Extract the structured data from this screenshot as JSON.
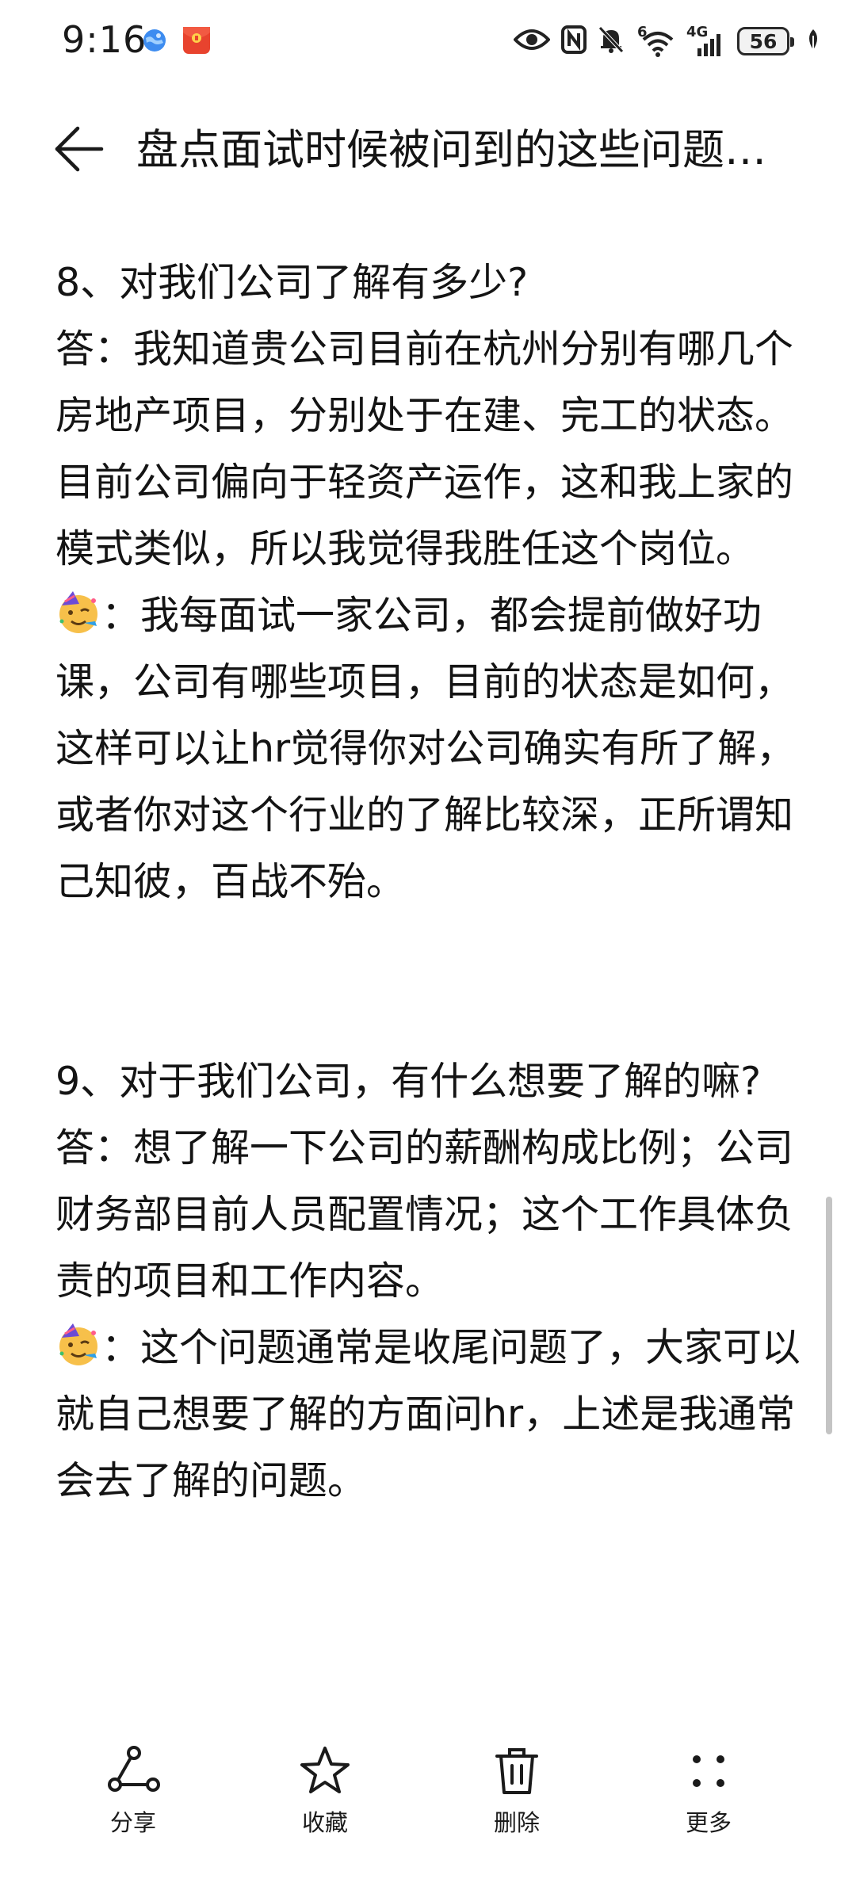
{
  "status_bar": {
    "time": "9:16",
    "left_icons": [
      "browser-globe-icon",
      "red-packet-app-icon"
    ],
    "right_icons": [
      "eye-icon",
      "nfc-icon",
      "mute-bell-icon",
      "wifi-6-icon",
      "cellular-4g-icon",
      "battery-icon",
      "leaf-icon"
    ],
    "wifi_label": "6",
    "network_label": "4G",
    "battery_level": "56"
  },
  "header": {
    "title": "盘点面试时候被问到的这些问题…"
  },
  "content": {
    "section_8": {
      "question": "8、对我们公司了解有多少?",
      "answer": "答：我知道贵公司目前在杭州分别有哪几个房地产项目，分别处于在建、完工的状态。目前公司偏向于轻资产运作，这和我上家的模式类似，所以我觉得我胜任这个岗位。",
      "tip": "：我每面试一家公司，都会提前做好功课，公司有哪些项目，目前的状态是如何，这样可以让hr觉得你对公司确实有所了解，或者你对这个行业的了解比较深，正所谓知己知彼，百战不殆。"
    },
    "section_9": {
      "question": "9、对于我们公司，有什么想要了解的嘛?",
      "answer": "答：想了解一下公司的薪酬构成比例；公司财务部目前人员配置情况；这个工作具体负责的项目和工作内容。",
      "tip": "：这个问题通常是收尾问题了，大家可以就自己想要了解的方面问hr，上述是我通常会去了解的问题。"
    }
  },
  "toolbar": {
    "share_label": "分享",
    "favorite_label": "收藏",
    "delete_label": "删除",
    "more_label": "更多"
  },
  "colors": {
    "text": "#141414",
    "background": "#ffffff",
    "scrollbar": "#c4c4c4",
    "emoji_face": "#f7c04a"
  }
}
